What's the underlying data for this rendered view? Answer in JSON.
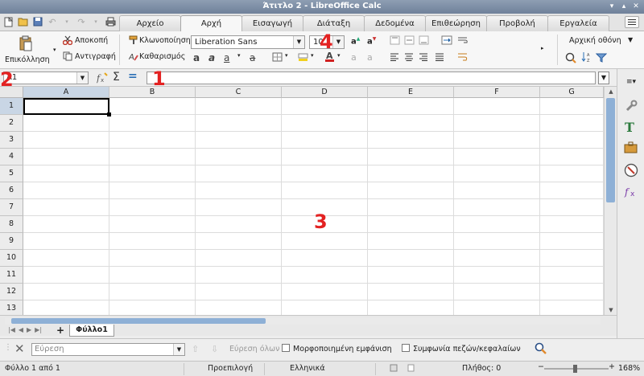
{
  "window": {
    "title": "Άτιτλο 2 - LibreOffice Calc"
  },
  "tabs": [
    "Αρχείο",
    "Αρχή",
    "Εισαγωγή",
    "Διάταξη",
    "Δεδομένα",
    "Επιθεώρηση",
    "Προβολή",
    "Εργαλεία"
  ],
  "active_tab": "Αρχή",
  "ribbon": {
    "paste_label": "Επικόλληση",
    "cut_label": "Αποκοπή",
    "copy_label": "Αντιγραφή",
    "clone_label": "Κλωνοποίηση",
    "clear_label": "Καθαρισμός",
    "font_name": "Liberation Sans",
    "font_size": "10",
    "home_screen_label": "Αρχική οθόνη"
  },
  "formula_bar": {
    "name_box": "A1",
    "formula": ""
  },
  "grid": {
    "columns": [
      "A",
      "B",
      "C",
      "D",
      "E",
      "F",
      "G"
    ],
    "rows": [
      "1",
      "2",
      "3",
      "4",
      "5",
      "6",
      "7",
      "8",
      "9",
      "10",
      "11",
      "12",
      "13"
    ],
    "selected_cell": "A1"
  },
  "sheets": {
    "tabs": [
      "Φύλλο1"
    ],
    "active": "Φύλλο1"
  },
  "find_toolbar": {
    "placeholder": "Εύρεση",
    "find_all_label": "Εύρεση όλων",
    "formatted_display_label": "Μορφοποιημένη εμφάνιση",
    "match_case_label": "Συμφωνία πεζών/κεφαλαίων"
  },
  "status_bar": {
    "sheet_info": "Φύλλο 1 από 1",
    "page_style": "Προεπιλογή",
    "language": "Ελληνικά",
    "count": "Πλήθος: 0",
    "zoom": "168%"
  },
  "annotations": [
    "1",
    "2",
    "3",
    "4"
  ],
  "colors": {
    "accent": "#8eb0d6",
    "annotation": "#e32222",
    "selection_header": "#c9d6e5"
  }
}
